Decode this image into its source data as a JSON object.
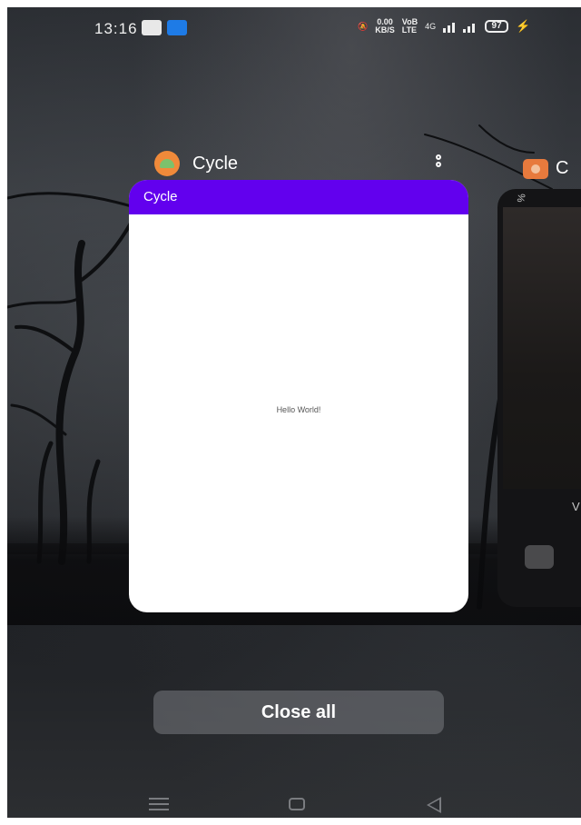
{
  "status_bar": {
    "time": "13:16",
    "net_speed_value": "0.00",
    "net_speed_unit": "KB/S",
    "volte_top": "VoB",
    "volte_bottom": "LTE",
    "network": "4G",
    "battery": "97"
  },
  "recent_apps": {
    "primary_app": {
      "name": "Cycle",
      "toolbar_title": "Cycle",
      "content_text": "Hello World!"
    },
    "secondary_app": {
      "name_partial": "C",
      "visible_letter": "V",
      "visible_symbol": "%"
    }
  },
  "actions": {
    "close_all_label": "Close all"
  },
  "colors": {
    "app_bar": "#6200ee",
    "background": "#2b2e33"
  }
}
